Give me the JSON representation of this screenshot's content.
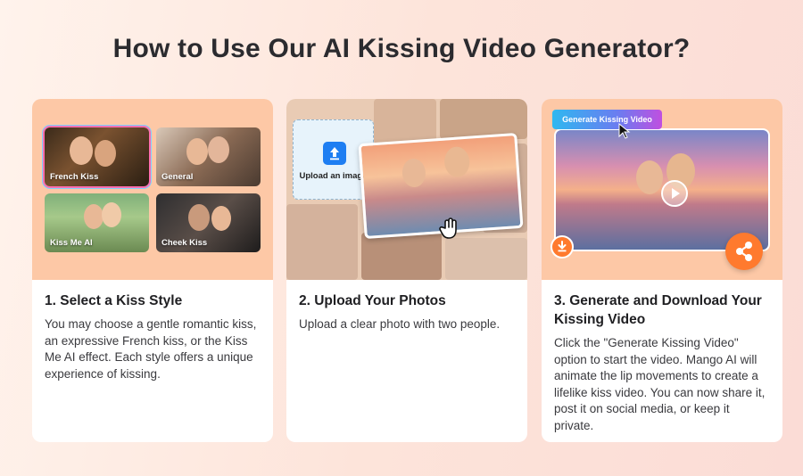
{
  "title": "How to Use Our AI Kissing Video Generator?",
  "colors": {
    "accent": "#ff7a2e",
    "visual_bg": "#fdc8a6",
    "upload_blue": "#1e7ef2"
  },
  "steps": [
    {
      "title": "1. Select a Kiss Style",
      "description": "You may choose a gentle romantic kiss, an expressive French kiss, or the Kiss Me AI effect. Each style offers a unique experience of kissing.",
      "styles": [
        "French Kiss",
        "General",
        "Kiss Me AI",
        "Cheek Kiss"
      ]
    },
    {
      "title": "2. Upload Your Photos",
      "description": "Upload a clear photo with two people.",
      "upload_label": "Upload an image"
    },
    {
      "title": "3. Generate and Download Your Kissing Video",
      "description": "Click the \"Generate Kissing Video\" option to start the video. Mango AI will animate the lip movements to create a lifelike kiss video. You can now share it, post it on social media, or keep it private.",
      "generate_label": "Generate Kissing Video"
    }
  ],
  "icons": [
    "upload-icon",
    "hand-cursor-icon",
    "arrow-cursor-icon",
    "play-icon",
    "download-icon",
    "share-icon"
  ]
}
